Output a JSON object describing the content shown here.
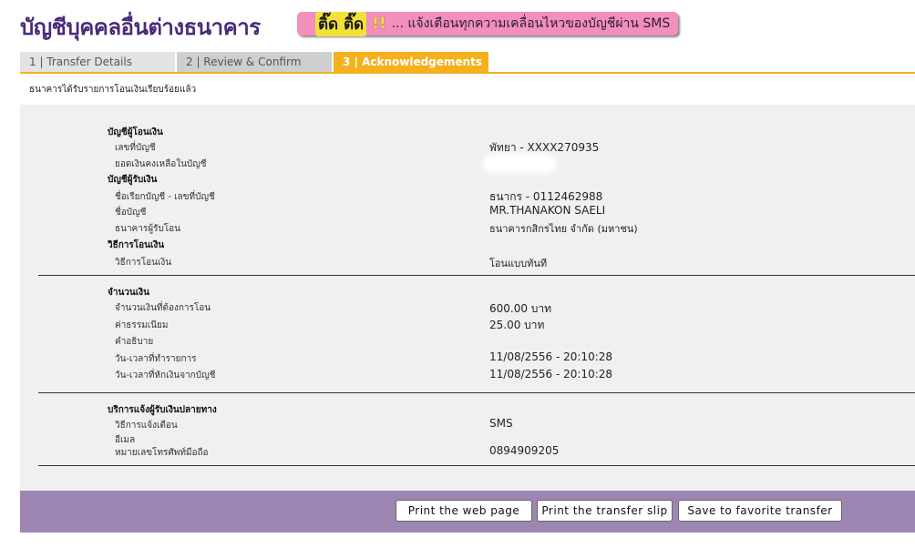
{
  "header": {
    "title": "บัญชีบุคคลอื่นต่างธนาคาร",
    "sms_banner": {
      "prefix": "ติ๊ด ติ๊ด",
      "bang": "!!",
      "message": "... แจ้งเตือนทุกความเคลื่อนไหวของบัญชีผ่าน SMS"
    }
  },
  "tabs": [
    {
      "label": "1 | Transfer Details"
    },
    {
      "label": "2 | Review & Confirm"
    },
    {
      "label": "3 | Acknowledgements"
    }
  ],
  "status_message": "ธนาคารได้รับรายการโอนเงินเรียบร้อยแล้ว",
  "from_account": {
    "heading": "บัญชีผู้โอนเงิน",
    "account_no_label": "เลขที่บัญชี",
    "account_no_value": "พัทยา - XXXX270935",
    "balance_label": "ยอดเงินคงเหลือในบัญชี"
  },
  "to_account": {
    "heading": "บัญชีผู้รับเงิน",
    "nickname_label": "ชื่อเรียกบัญชี - เลขที่บัญชี",
    "nickname_value": "ธนากร - 0112462988",
    "account_name_label": "ชื่อบัญชี",
    "account_name_value": "MR.THANAKON SAELI",
    "bank_label": "ธนาคารผู้รับโอน",
    "bank_value": "ธนาคารกสิกรไทย จำกัด (มหาชน)"
  },
  "transfer_method": {
    "heading": "วิธีการโอนเงิน",
    "method_label": "วิธีการโอนเงิน",
    "method_value": "โอนแบบทันที"
  },
  "amount": {
    "heading": "จำนวนเงิน",
    "amount_label": "จำนวนเงินที่ต้องการโอน",
    "amount_value": "600.00 บาท",
    "fee_label": "ค่าธรรมเนียม",
    "fee_value": "25.00 บาท",
    "desc_label": "คำอธิบาย",
    "txn_datetime_label": "วัน-เวลาที่ทำรายการ",
    "txn_datetime_value": "11/08/2556 - 20:10:28",
    "debit_datetime_label": "วัน-เวลาที่หักเงินจากบัญชี",
    "debit_datetime_value": "11/08/2556 - 20:10:28"
  },
  "notification": {
    "heading": "บริการแจ้งผู้รับเงินปลายทาง",
    "method_label": "วิธีการแจ้งเตือน",
    "method_value": "SMS",
    "email_label": "อีเมล",
    "phone_label": "หมายเลขโทรศัพท์มือถือ",
    "phone_value": "0894909205"
  },
  "buttons": {
    "print_web": "Print the web page",
    "print_slip": "Print the transfer slip",
    "save_favorite": "Save to favorite transfer"
  },
  "colors": {
    "title": "#4a2a7a",
    "banner_bg": "#f28fbd",
    "active_tab": "#f5b01e",
    "footer_bar": "#9e86b2",
    "panel_bg": "#f0f0f0"
  }
}
